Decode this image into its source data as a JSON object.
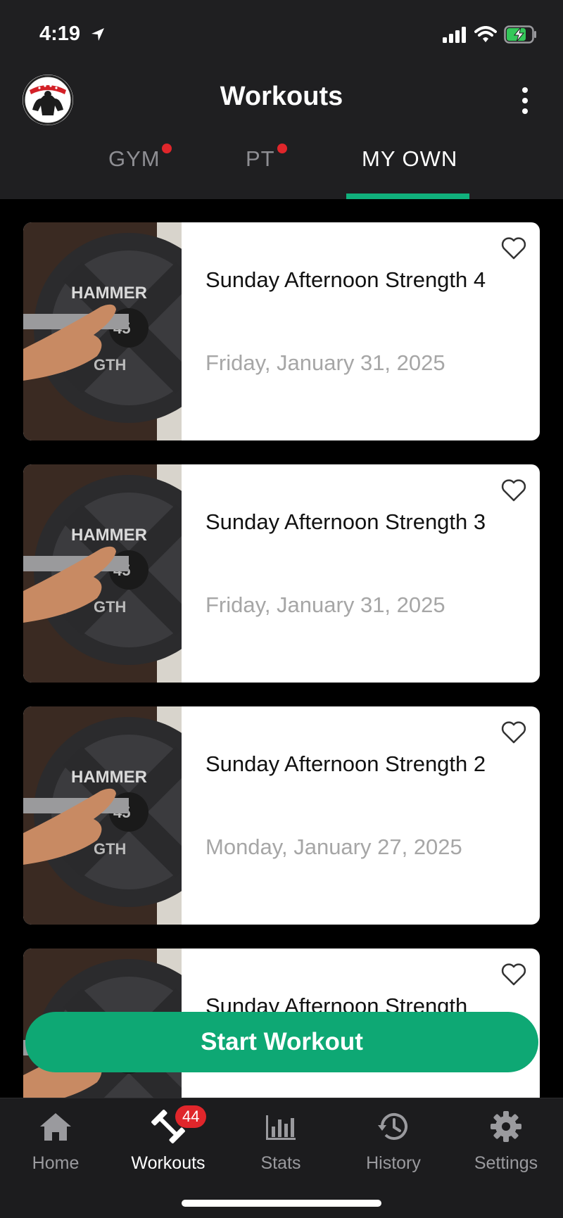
{
  "status_bar": {
    "time": "4:19"
  },
  "header": {
    "title": "Workouts"
  },
  "tabs": [
    {
      "label": "GYM",
      "has_dot": true,
      "active": false
    },
    {
      "label": "PT",
      "has_dot": true,
      "active": false
    },
    {
      "label": "MY OWN",
      "has_dot": false,
      "active": true
    }
  ],
  "workouts": [
    {
      "title": "Sunday Afternoon Strength 4",
      "date": "Friday, January 31, 2025"
    },
    {
      "title": "Sunday Afternoon Strength 3",
      "date": "Friday, January 31, 2025"
    },
    {
      "title": "Sunday Afternoon Strength 2",
      "date": "Monday, January 27, 2025"
    },
    {
      "title": "Sunday Afternoon Strength",
      "date": ""
    }
  ],
  "start_button": {
    "label": "Start Workout"
  },
  "nav": {
    "home": "Home",
    "workouts": "Workouts",
    "workouts_badge": "44",
    "stats": "Stats",
    "history": "History",
    "settings": "Settings"
  },
  "colors": {
    "accent": "#0ea874",
    "badge": "#e0262b",
    "bar": "#1f1f21"
  },
  "icons": [
    "location-arrow-icon",
    "signal-icon",
    "wifi-icon",
    "battery-charging-icon",
    "more-vertical-icon",
    "heart-icon",
    "home-icon",
    "dumbbell-icon",
    "bar-chart-icon",
    "history-icon",
    "gear-icon"
  ]
}
